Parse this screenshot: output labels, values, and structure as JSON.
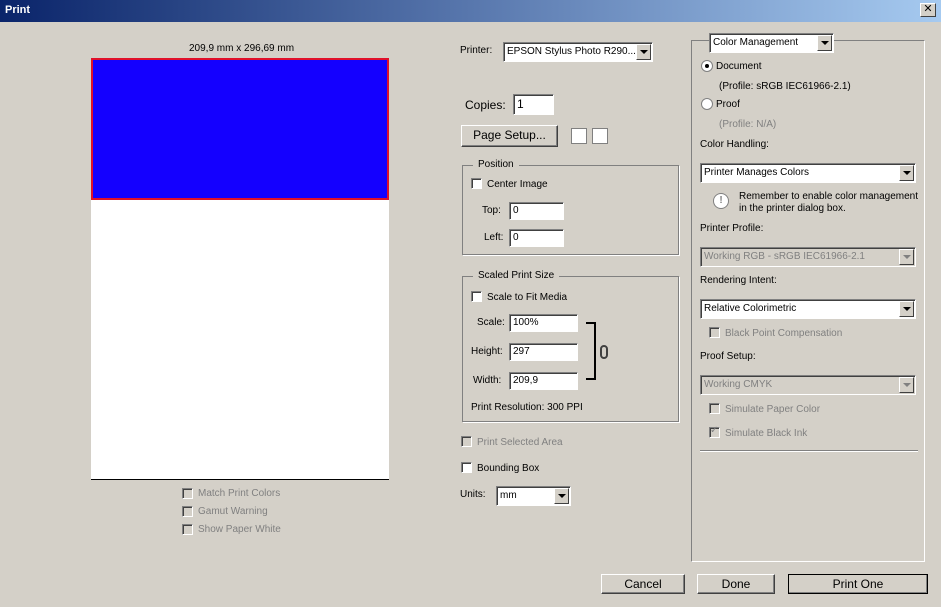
{
  "window": {
    "title": "Print"
  },
  "preview": {
    "dimensions": "209,9 mm x 296,69 mm",
    "image_color": "#1400ff",
    "border_color": "#e0102a",
    "match_print_colors": "Match Print Colors",
    "gamut_warning": "Gamut Warning",
    "show_paper_white": "Show Paper White"
  },
  "printer": {
    "label": "Printer:",
    "value": "EPSON Stylus Photo R290...",
    "copies_label": "Copies:",
    "copies_value": "1",
    "page_setup": "Page Setup..."
  },
  "position": {
    "title": "Position",
    "center_image": "Center Image",
    "top_label": "Top:",
    "top_value": "0",
    "left_label": "Left:",
    "left_value": "0"
  },
  "scaled": {
    "title": "Scaled Print Size",
    "scale_to_fit": "Scale to Fit Media",
    "scale_label": "Scale:",
    "scale_value": "100%",
    "height_label": "Height:",
    "height_value": "297",
    "width_label": "Width:",
    "width_value": "209,9",
    "resolution": "Print Resolution: 300 PPI"
  },
  "options": {
    "print_selected_area": "Print Selected Area",
    "bounding_box": "Bounding Box",
    "units_label": "Units:",
    "units_value": "mm"
  },
  "color": {
    "section": "Color Management",
    "document": "Document",
    "document_profile": "(Profile: sRGB IEC61966-2.1)",
    "proof": "Proof",
    "proof_profile": "(Profile: N/A)",
    "handling_label": "Color Handling:",
    "handling_value": "Printer Manages Colors",
    "reminder": "Remember to enable color management in the printer dialog box.",
    "printer_profile_label": "Printer Profile:",
    "printer_profile_value": "Working RGB - sRGB IEC61966-2.1",
    "intent_label": "Rendering Intent:",
    "intent_value": "Relative Colorimetric",
    "black_point": "Black Point Compensation",
    "proof_setup_label": "Proof Setup:",
    "proof_setup_value": "Working CMYK",
    "simulate_paper": "Simulate Paper Color",
    "simulate_ink": "Simulate Black Ink"
  },
  "buttons": {
    "cancel": "Cancel",
    "done": "Done",
    "print_one": "Print One"
  }
}
